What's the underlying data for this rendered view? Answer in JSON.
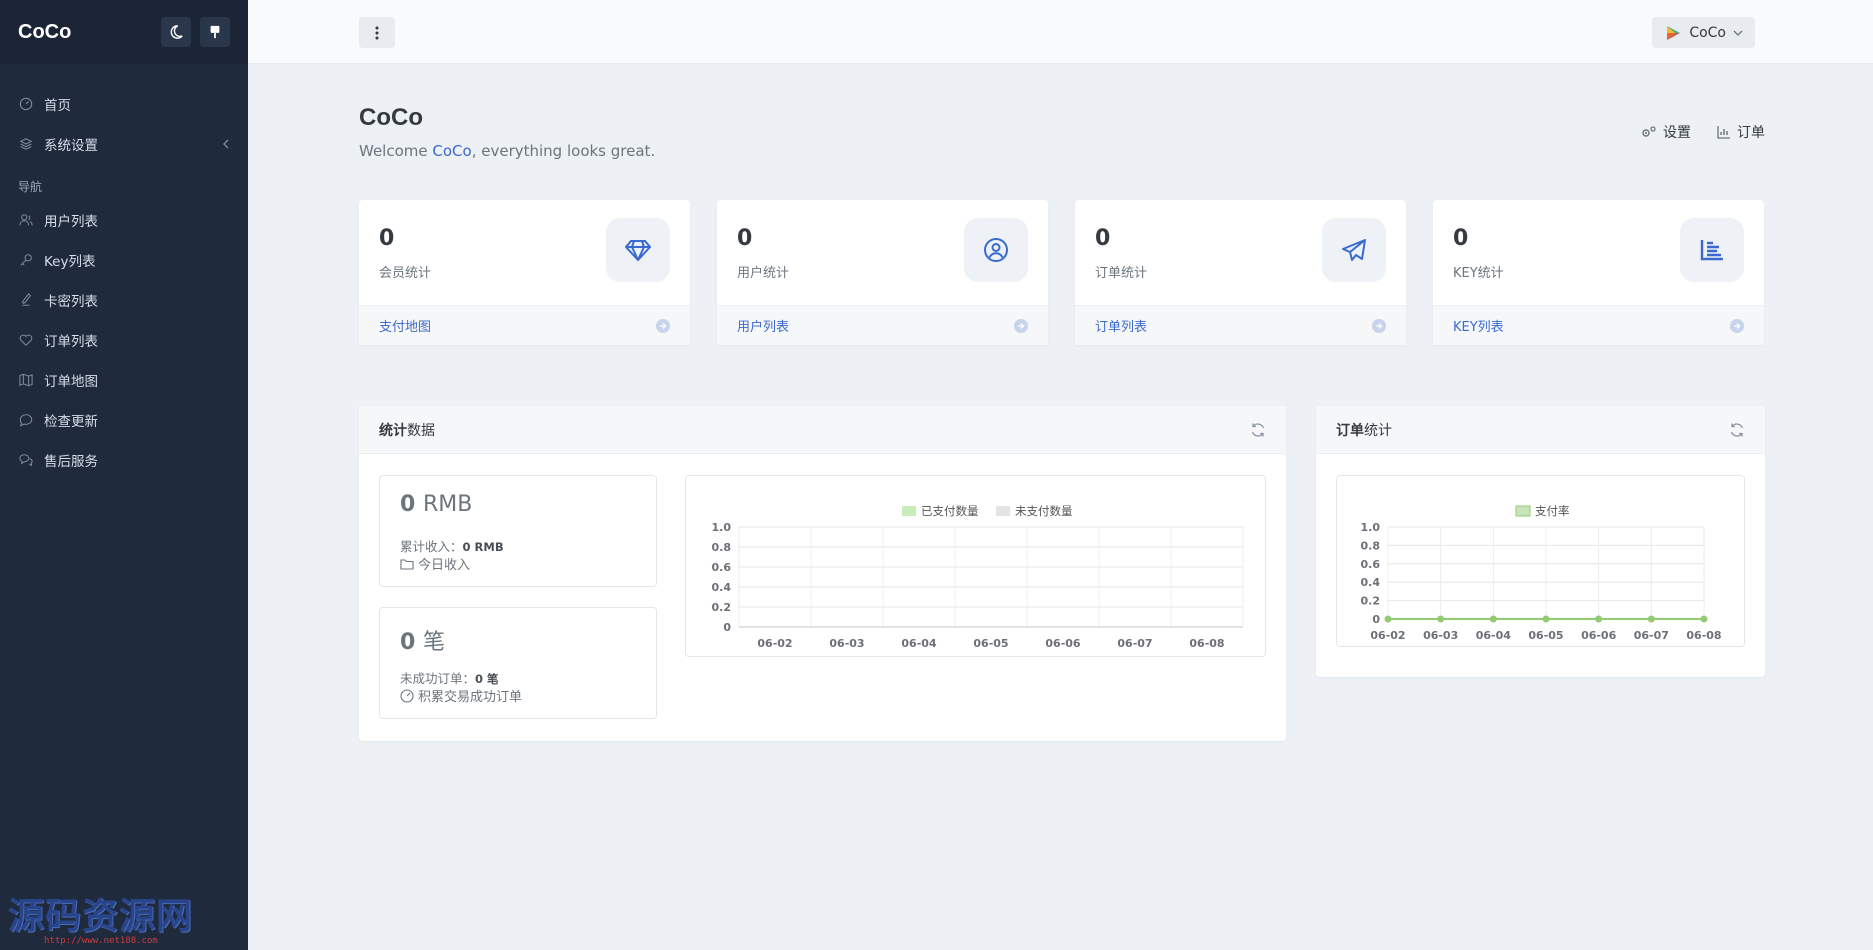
{
  "app": {
    "brand": "CoCo"
  },
  "sidebar": {
    "items": [
      {
        "label": "首页",
        "icon": "dashboard-icon"
      },
      {
        "label": "系统设置",
        "icon": "layers-icon",
        "expandable": true
      }
    ],
    "section_heading": "导航",
    "nav_items": [
      {
        "label": "用户列表",
        "icon": "users-icon"
      },
      {
        "label": "Key列表",
        "icon": "key-icon"
      },
      {
        "label": "卡密列表",
        "icon": "pen-icon"
      },
      {
        "label": "订单列表",
        "icon": "heart-icon"
      },
      {
        "label": "订单地图",
        "icon": "map-icon"
      },
      {
        "label": "检查更新",
        "icon": "comment-icon"
      },
      {
        "label": "售后服务",
        "icon": "comments-icon"
      }
    ],
    "watermark": {
      "title": "源码资源网",
      "url": "http://www.net188.com"
    }
  },
  "topbar": {
    "user_name": "CoCo"
  },
  "page": {
    "title": "CoCo",
    "welcome_prefix": "Welcome ",
    "welcome_name": "CoCo",
    "welcome_suffix": ", everything looks great.",
    "actions": {
      "settings": "设置",
      "orders": "订单"
    }
  },
  "stats": [
    {
      "value": "0",
      "caption": "会员统计",
      "link": "支付地图",
      "icon": "diamond-icon"
    },
    {
      "value": "0",
      "caption": "用户统计",
      "link": "用户列表",
      "icon": "user-circle-icon"
    },
    {
      "value": "0",
      "caption": "订单统计",
      "link": "订单列表",
      "icon": "paper-plane-icon"
    },
    {
      "value": "0",
      "caption": "KEY统计",
      "link": "KEY列表",
      "icon": "bar-chart-icon"
    }
  ],
  "panel_stats": {
    "title_bold": "统计",
    "title_rest": "数据",
    "revenue": {
      "value": "0",
      "unit": "RMB",
      "line1_label": "累计收入：",
      "line1_value": "0 RMB",
      "line2": "今日收入"
    },
    "orders": {
      "value": "0",
      "unit": "笔",
      "line1_label": "未成功订单：",
      "line1_value": "0 笔",
      "line2": "积累交易成功订单"
    }
  },
  "panel_orders": {
    "title_bold": "订单",
    "title_rest": "统计"
  },
  "colors": {
    "accent": "#3a6ad0",
    "sidebar": "#1f2a3c",
    "chart_green": "#91cc75"
  },
  "chart_data": [
    {
      "type": "bar",
      "categories": [
        "06-02",
        "06-03",
        "06-04",
        "06-05",
        "06-06",
        "06-07",
        "06-08"
      ],
      "series": [
        {
          "name": "已支付数量",
          "values": [
            0,
            0,
            0,
            0,
            0,
            0,
            0
          ],
          "color": "#c9ecb8"
        },
        {
          "name": "未支付数量",
          "values": [
            0,
            0,
            0,
            0,
            0,
            0,
            0
          ],
          "color": "#e4e4e4"
        }
      ],
      "yticks": [
        "0",
        "0.2",
        "0.4",
        "0.6",
        "0.8",
        "1.0"
      ],
      "ylim": [
        0,
        1
      ],
      "legend": "top-center",
      "grid": true
    },
    {
      "type": "line",
      "categories": [
        "06-02",
        "06-03",
        "06-04",
        "06-05",
        "06-06",
        "06-07",
        "06-08"
      ],
      "series": [
        {
          "name": "支付率",
          "values": [
            0,
            0,
            0,
            0,
            0,
            0,
            0
          ],
          "color": "#91cc75"
        }
      ],
      "yticks": [
        "0",
        "0.2",
        "0.4",
        "0.6",
        "0.8",
        "1.0"
      ],
      "ylim": [
        0,
        1
      ],
      "legend": "top-center",
      "grid": true
    }
  ]
}
